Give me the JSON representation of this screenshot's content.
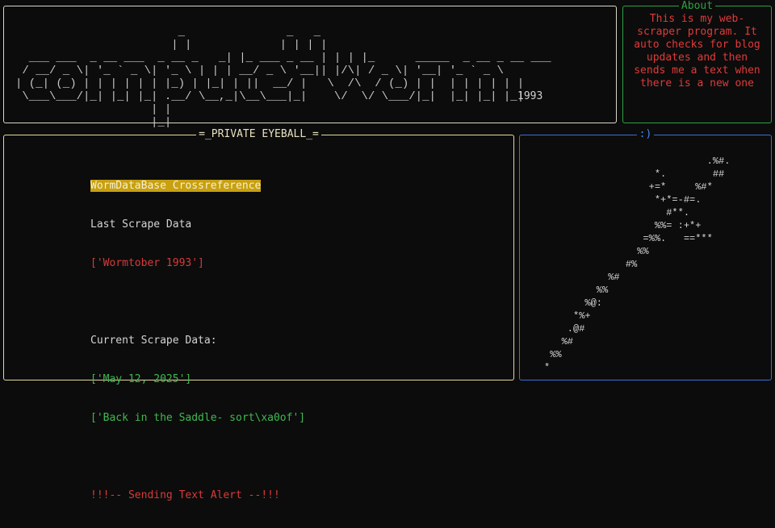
{
  "header": {
    "banner_art": "                        _               _   _\n                       | |             | | | |\n  ___ ___  _ __ ___  _ __ _   _| |_ ___ _ __ | | | |_      _____  _ __ _ __ ___\n / __/ _ \\| '_ ` _ \\| '_ \\ | | | __/ _ \\ '__|| |/\\| / _ \\| '__| '_ ` _ \\\n| (_| (_) | | | | | | |_) | |_| | ||  __/ |   \\  /\\  / (_) | |  | | | | | |\n \\___\\___/|_| |_| |_| .__/ \\__,_|\\__\\___|_|    \\/  \\/ \\___/|_|  |_| |_| |_|\n                    | |\n                    |_|",
    "year": "1993"
  },
  "about": {
    "title": "About",
    "text": "This is my web-scraper program. It auto checks for blog updates and then sends me a text when there is a new one"
  },
  "eyeball": {
    "title": "=_PRIVATE EYEBALL_=",
    "section_heading": "WormDataBase Crossreference",
    "last_label": "Last Scrape Data",
    "last_value": "['Wormtober 1993']",
    "current_label": "Current Scrape Data:",
    "current_date": "['May 12, 2025']",
    "current_title": "['Back in the Saddle- sort\\xa0of']",
    "alert": "!!!-- Sending Text Alert --!!!"
  },
  "smiley": {
    "title": ":)",
    "worm_art": "                            .%#.\n                   *.        ##\n                  +=*     %#*\n                   *+*=-#=.\n                     #**.\n                   %%= :+*+\n                 =%%.   ==***\n                %%\n              #%\n           %#\n         %%\n       %@:\n     *%+\n    .@#\n   %#\n %%\n*"
  }
}
